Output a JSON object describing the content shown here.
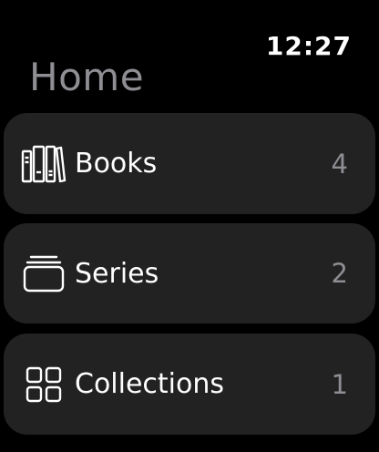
{
  "status": {
    "time": "12:27"
  },
  "page": {
    "title": "Home"
  },
  "items": [
    {
      "label": "Books",
      "count": "4",
      "icon": "books-icon"
    },
    {
      "label": "Series",
      "count": "2",
      "icon": "stack-icon"
    },
    {
      "label": "Collections",
      "count": "1",
      "icon": "grid-icon"
    }
  ],
  "colors": {
    "background": "#000000",
    "row_background": "#222223",
    "secondary_text": "#8e8e93",
    "primary_text": "#ffffff"
  }
}
